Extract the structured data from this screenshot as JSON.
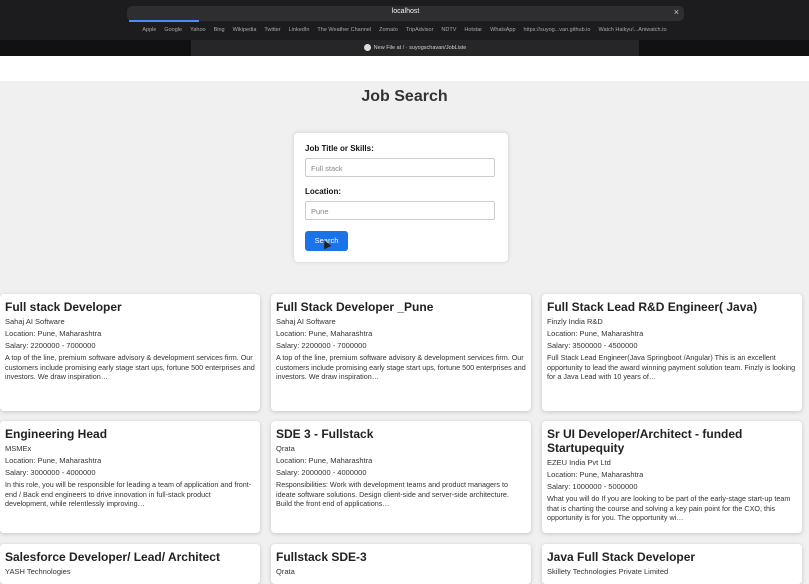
{
  "browser": {
    "url": "localhost",
    "favorites": [
      "Apple",
      "Google",
      "Yahoo",
      "Bing",
      "Wikipedia",
      "Twitter",
      "LinkedIn",
      "The Weather Channel",
      "Zomato",
      "TripAdvisor",
      "NDTV",
      "Hotstar",
      "WhatsApp",
      "https://suyog...van.github.io",
      "Watch Haikyu!...Aniwatch.to"
    ],
    "tab_title": "New File at / · suyogschavan/JobListe",
    "close_icon": "×"
  },
  "page": {
    "title": "Job Search"
  },
  "form": {
    "skills_label": "Job Title or Skills:",
    "skills_value": "Full stack",
    "location_label": "Location:",
    "location_value": "Pune",
    "search_label": "Search",
    "accent": "#1a73e8"
  },
  "jobs": [
    {
      "title": "Full stack Developer",
      "company": "Sahaj AI Software",
      "location": "Location: Pune, Maharashtra",
      "salary": "Salary: 2200000 - 7000000",
      "desc": "A top of the line, premium software advisory & development services firm. Our customers include promising early stage start ups, fortune 500 enterprises and investors. We draw inspiration…"
    },
    {
      "title": "Full Stack Developer _Pune",
      "company": "Sahaj AI Software",
      "location": "Location: Pune, Maharashtra",
      "salary": "Salary: 2200000 - 7000000",
      "desc": "A top of the line, premium software advisory & development services firm. Our customers include promising early stage start ups, fortune 500 enterprises and investors. We draw inspiration…"
    },
    {
      "title": "Full Stack Lead R&D Engineer( Java)",
      "company": "Finzly India R&D",
      "location": "Location: Pune, Maharashtra",
      "salary": "Salary: 3500000 - 4500000",
      "desc": "Full Stack Lead Engineer(Java Springboot /Angular) This is an excellent opportunity to lead the award winning payment solution team. Finzly is looking for a Java Lead with 10 years of…"
    },
    {
      "title": "Engineering Head",
      "company": "MSMEx",
      "location": "Location: Pune, Maharashtra",
      "salary": "Salary: 3000000 - 4000000",
      "desc": "In this role, you will be responsible for leading a team of application and front-end / Back end engineers to drive innovation in full-stack product development, while relentlessly improving…"
    },
    {
      "title": "SDE 3 - Fullstack",
      "company": "Qrata",
      "location": "Location: Pune, Maharashtra",
      "salary": "Salary: 2000000 - 4000000",
      "desc": "Responsibilities: Work with development teams and product managers to ideate software solutions. Design client-side and server-side architecture. Build the front end of applications…"
    },
    {
      "title": "Sr UI Developer/Architect - funded Startupequity",
      "company": "EZEU India Pvt Ltd",
      "location": "Location: Pune, Maharashtra",
      "salary": "Salary: 1000000 - 5000000",
      "desc": "What you will do If you are looking to be part of the early-stage start-up team that is charting the course and solving a key pain point for the CXO, this opportunity is for you. The opportunity wi…"
    },
    {
      "title": "Salesforce Developer/ Lead/ Architect",
      "company": "YASH Technologies",
      "location": "",
      "salary": "",
      "desc": ""
    },
    {
      "title": "Fullstack SDE-3",
      "company": "Qrata",
      "location": "",
      "salary": "",
      "desc": ""
    },
    {
      "title": "Java Full Stack Developer",
      "company": "Skillety Technologies Private Limited",
      "location": "",
      "salary": "",
      "desc": ""
    }
  ]
}
